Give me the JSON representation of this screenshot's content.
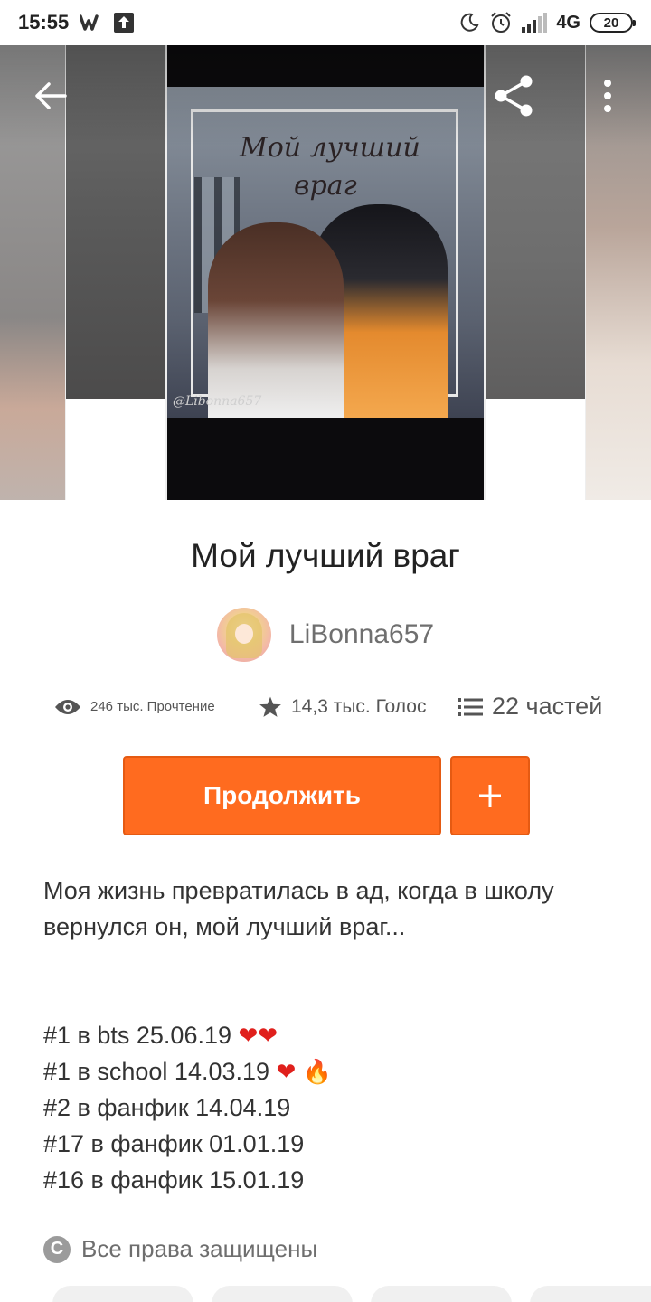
{
  "status_bar": {
    "time": "15:55",
    "network": "4G",
    "battery": "20"
  },
  "cover": {
    "title_line_1": "Мой лучший",
    "title_line_2": "враг",
    "signature": "@Libonna657"
  },
  "story": {
    "title": "Мой лучший враг",
    "author": "LiBonna657"
  },
  "stats": {
    "reads": "246 тыс. Прочтение",
    "votes": "14,3 тыс. Голос",
    "parts": "22 частей"
  },
  "actions": {
    "continue_label": "Продолжить",
    "add_label": "+"
  },
  "description": {
    "lines": [
      "Моя жизнь превратилась в ад, когда в школу",
      "вернулся он, мой лучший враг..."
    ],
    "rankings": [
      "#1 в bts 25.06.19",
      "#1 в school 14.03.19",
      "#2 в фанфик 14.04.19",
      "#17 в фанфик 01.01.19",
      "#16 в фанфик 15.01.19"
    ]
  },
  "copyright": {
    "text": "Все права защищены"
  },
  "icons": {
    "back": "arrow-left-icon",
    "share": "share-icon",
    "more": "more-vertical-icon",
    "reads": "eye-icon",
    "votes": "star-icon",
    "parts": "list-icon",
    "copyright": "copyright-icon"
  },
  "colors": {
    "accent": "#ff6b1f",
    "heart": "#e0201c"
  }
}
